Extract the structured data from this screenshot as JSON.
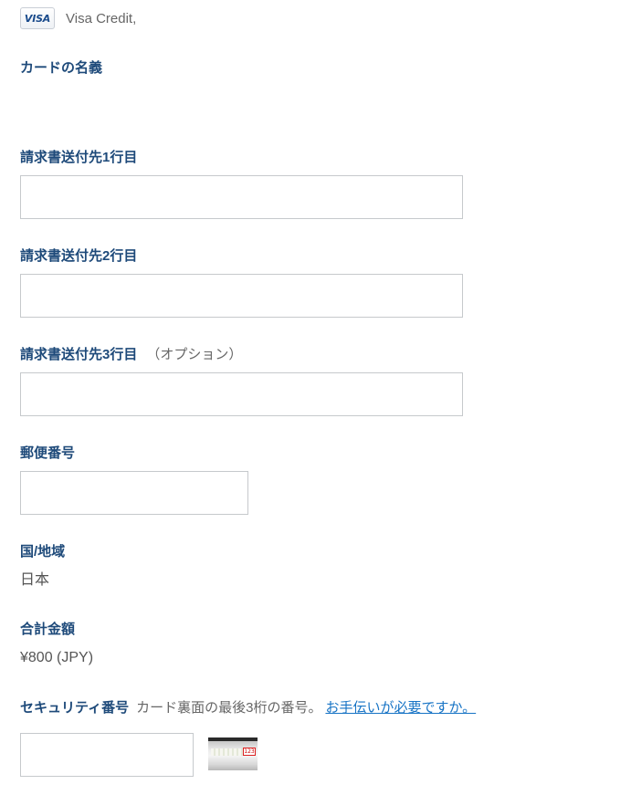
{
  "card": {
    "brand_badge": "VISA",
    "description": "Visa Credit,"
  },
  "cardholder": {
    "label": "カードの名義",
    "value": ""
  },
  "address1": {
    "label": "請求書送付先1行目",
    "value": ""
  },
  "address2": {
    "label": "請求書送付先2行目",
    "value": ""
  },
  "address3": {
    "label": "請求書送付先3行目",
    "note": "（オプション）",
    "value": ""
  },
  "postal": {
    "label": "郵便番号",
    "value": ""
  },
  "country": {
    "label": "国/地域",
    "value": "日本"
  },
  "total": {
    "label": "合計金額",
    "value": "¥800 (JPY)"
  },
  "security": {
    "label": "セキュリティ番号",
    "hint": "カード裏面の最後3桁の番号。",
    "help_link": "お手伝いが必要ですか。",
    "value": "",
    "sample_code": "123",
    "icon": "card-back-cvv-icon"
  },
  "colors": {
    "label": "#1e4a7a",
    "link": "#1673c5",
    "muted_text": "#666666",
    "input_border": "#c6c9cc"
  }
}
